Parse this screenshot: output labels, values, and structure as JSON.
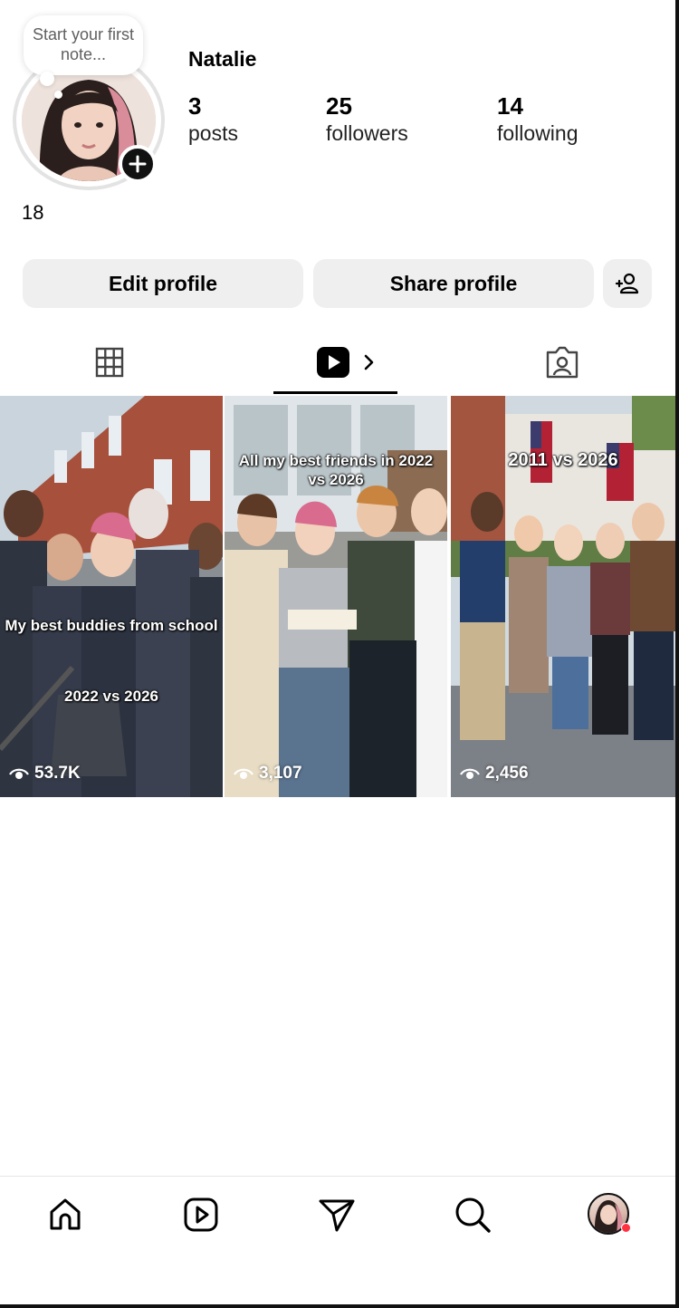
{
  "profile": {
    "note_placeholder": "Start your first note...",
    "name": "Natalie",
    "bio": "18"
  },
  "stats": [
    {
      "value": "3",
      "label": "posts"
    },
    {
      "value": "25",
      "label": "followers"
    },
    {
      "value": "14",
      "label": "following"
    }
  ],
  "actions": {
    "edit_profile": "Edit profile",
    "share_profile": "Share profile"
  },
  "tabs": [
    "grid-icon",
    "reels-icon",
    "tagged-icon"
  ],
  "posts": [
    {
      "caption": "My best buddies from school",
      "caption2": "2022 vs 2026",
      "views": "53.7K"
    },
    {
      "caption": "All my best friends in 2022 vs 2026",
      "views": "3,107"
    },
    {
      "caption": "2011 vs 2026",
      "views": "2,456"
    }
  ],
  "nav": [
    "home-icon",
    "reels-icon",
    "send-icon",
    "search-icon",
    "profile-avatar"
  ],
  "colors": {
    "notification_dot": "#ff3040",
    "button_bg": "#efefef"
  }
}
